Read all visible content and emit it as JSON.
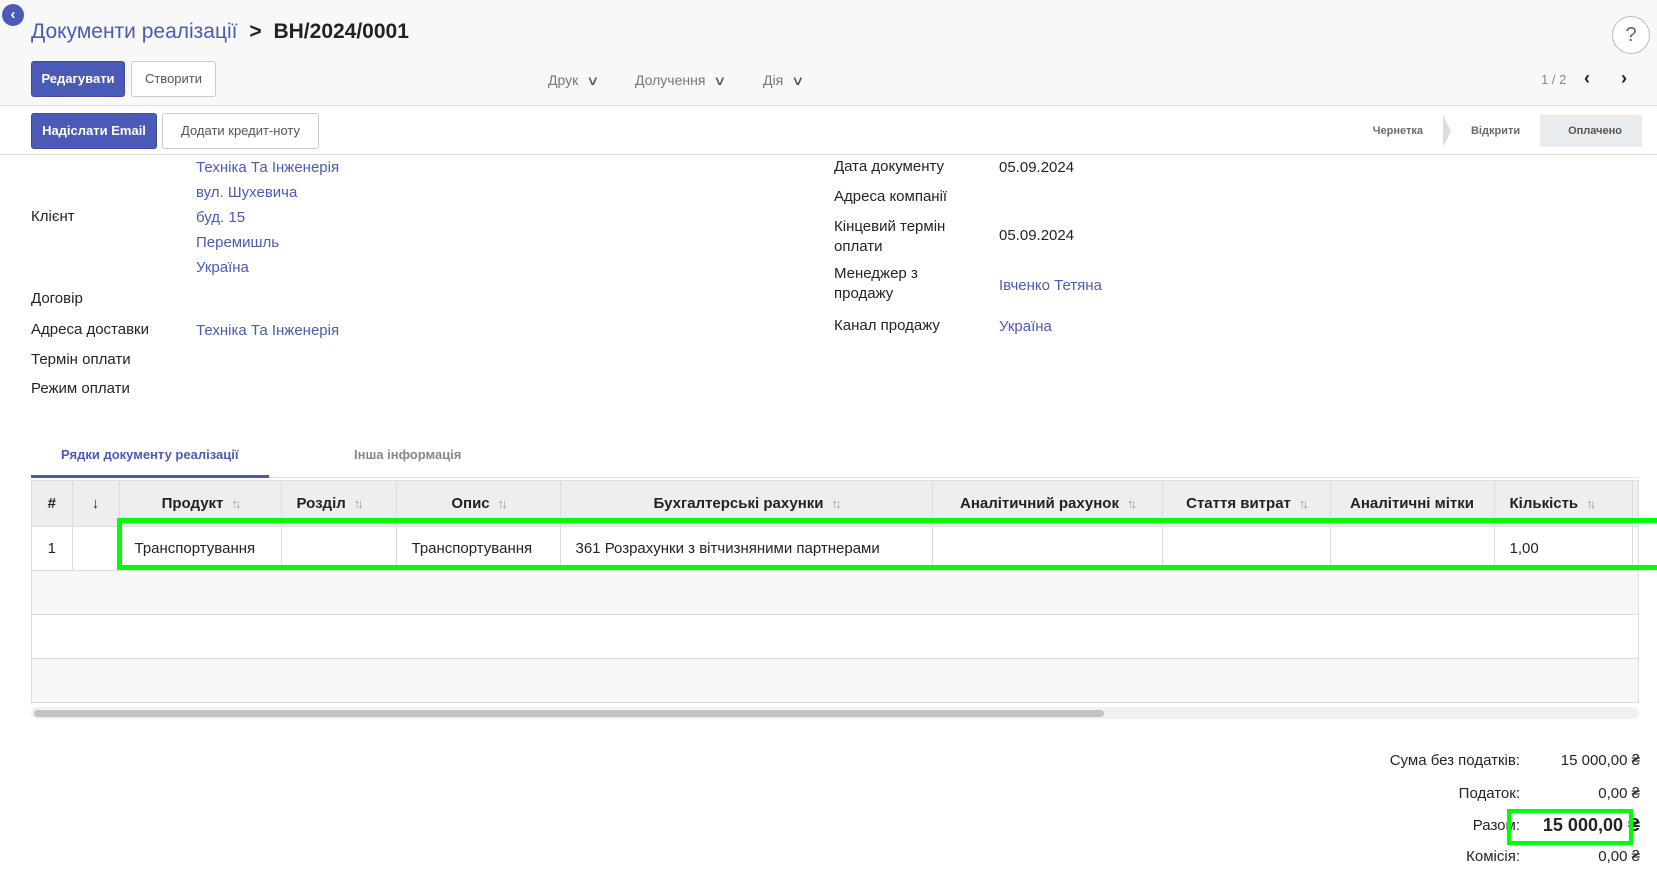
{
  "header": {
    "breadcrumb_parent": "Документи реалізації",
    "breadcrumb_sep": ">",
    "breadcrumb_current": "ВН/2024/0001",
    "help": "?"
  },
  "toolbar": {
    "edit_label": "Редагувати",
    "create_label": "Створити",
    "print_label": "Друк",
    "attachments_label": "Долучення",
    "action_label": "Дія",
    "pager": "1 / 2"
  },
  "statusbar": {
    "send_email_label": "Надіслати Email",
    "add_credit_note_label": "Додати кредит-ноту",
    "stages": [
      "Чернетка",
      "Відкрити",
      "Оплачено"
    ]
  },
  "form": {
    "client_label": "Клієнт",
    "client_lines": [
      "Техніка Та Інженерія",
      "вул. Шухевича",
      "буд. 15",
      "Перемишль",
      "Україна"
    ],
    "contract_label": "Договір",
    "delivery_label": "Адреса доставки",
    "delivery_value": "Техніка Та Інженерія",
    "payment_term_label": "Термін оплати",
    "payment_mode_label": "Режим оплати",
    "doc_date_label": "Дата документу",
    "doc_date_value": "05.09.2024",
    "company_address_label": "Адреса компанії",
    "due_date_label_1": "Кінцевий термін",
    "due_date_label_2": "оплати",
    "due_date_value": "05.09.2024",
    "manager_label_1": "Менеджер з",
    "manager_label_2": "продажу",
    "manager_value": "Івченко Тетяна",
    "channel_label": "Канал продажу",
    "channel_value": "Україна"
  },
  "tabs": {
    "lines": "Рядки документу реалізації",
    "other": "Інша інформація"
  },
  "table": {
    "headers": [
      "#",
      "↓",
      "Продукт",
      "Розділ",
      "Опис",
      "Бухгалтерські рахунки",
      "Аналітичний рахунок",
      "Стаття витрат",
      "Аналітичні мітки",
      "Кількість"
    ],
    "rows": [
      {
        "num": "1",
        "product": "Транспортування",
        "section": "",
        "description": "Транспортування",
        "account": "361 Розрахунки з вітчизняними партнерами",
        "analytic_account": "",
        "expense": "",
        "tags": "",
        "qty": "1,00"
      }
    ]
  },
  "totals": {
    "untaxed_label": "Сума без податків:",
    "untaxed_value": "15 000,00 ₴",
    "tax_label": "Податок:",
    "tax_value": "0,00 ₴",
    "total_label": "Разом:",
    "total_value": "15 000,00 ₴",
    "commission_label": "Комісія:",
    "commission_value": "0,00 ₴"
  },
  "colors": {
    "accent": "#4c5ab7",
    "highlight": "#00ff00"
  }
}
